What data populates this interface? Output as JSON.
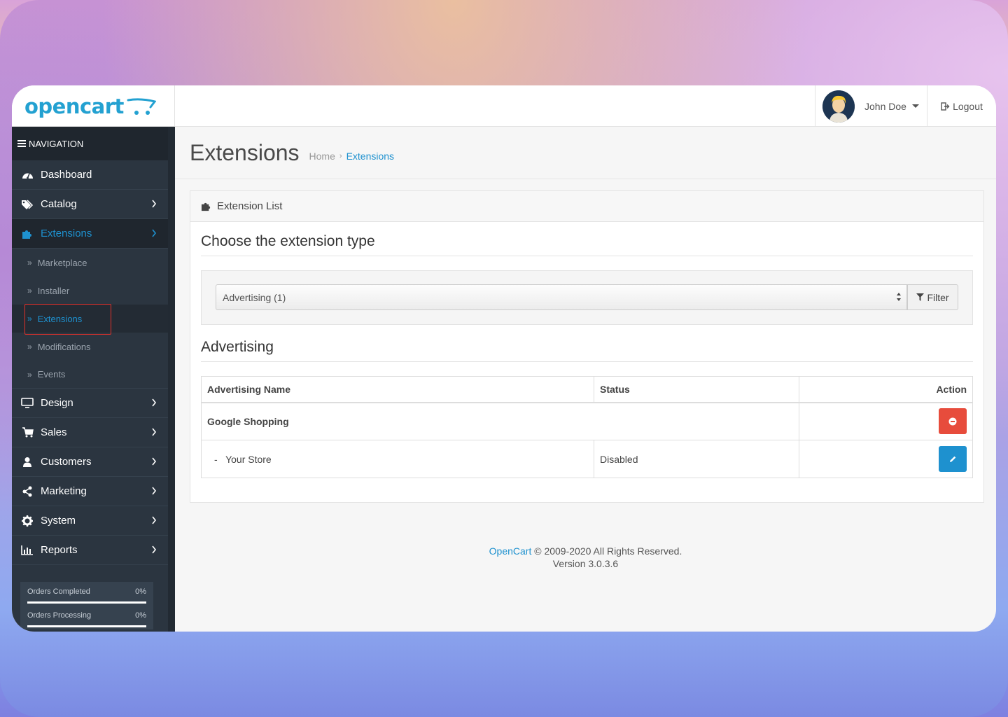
{
  "header": {
    "logo_text": "opencart",
    "user_name": "John Doe",
    "logout_label": "Logout"
  },
  "sidebar": {
    "nav_title": "NAVIGATION",
    "items": [
      {
        "label": "Dashboard",
        "icon": "dashboard-icon"
      },
      {
        "label": "Catalog",
        "icon": "tags-icon"
      },
      {
        "label": "Extensions",
        "icon": "puzzle-icon"
      },
      {
        "label": "Design",
        "icon": "monitor-icon"
      },
      {
        "label": "Sales",
        "icon": "cart-icon"
      },
      {
        "label": "Customers",
        "icon": "user-icon"
      },
      {
        "label": "Marketing",
        "icon": "share-icon"
      },
      {
        "label": "System",
        "icon": "cog-icon"
      },
      {
        "label": "Reports",
        "icon": "bar-chart-icon"
      }
    ],
    "sub_items": [
      "Marketplace",
      "Installer",
      "Extensions",
      "Modifications",
      "Events"
    ],
    "stats": [
      {
        "label": "Orders Completed",
        "value": "0%"
      },
      {
        "label": "Orders Processing",
        "value": "0%"
      }
    ]
  },
  "page": {
    "title": "Extensions",
    "breadcrumb": [
      "Home",
      "Extensions"
    ]
  },
  "panel": {
    "title": "Extension List",
    "choose_heading": "Choose the extension type",
    "select_value": "Advertising (1)",
    "filter_label": "Filter",
    "section_heading": "Advertising",
    "table": {
      "headers": [
        "Advertising Name",
        "Status",
        "Action"
      ],
      "rows": [
        {
          "name": "Google Shopping",
          "status": ""
        },
        {
          "name": "-   Your Store",
          "status": "Disabled"
        }
      ]
    }
  },
  "footer": {
    "link": "OpenCart",
    "copyright": " © 2009-2020 All Rights Reserved.",
    "version": "Version 3.0.3.6"
  },
  "colors": {
    "accent": "#1e91cf",
    "sidebar_bg": "#2b3540",
    "danger": "#e74c3c",
    "highlight_border": "#e0302a"
  }
}
